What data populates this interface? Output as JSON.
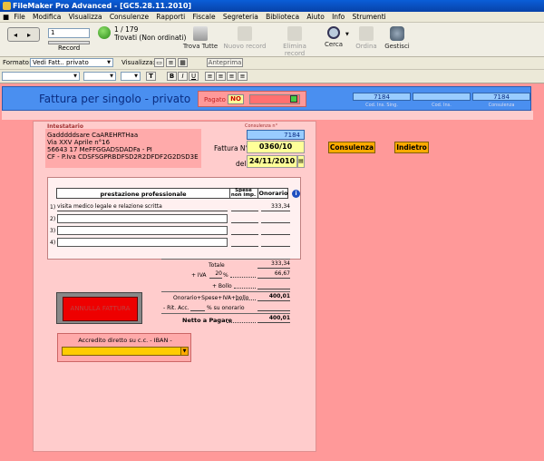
{
  "window": {
    "title": "FileMaker Pro Advanced - [GC5.28.11.2010]"
  },
  "menu": [
    "File",
    "Modifica",
    "Visualizza",
    "Consulenze",
    "Rapporti",
    "Fiscale",
    "Segreteria",
    "Biblioteca",
    "Aiuto",
    "Info",
    "Strumenti"
  ],
  "toolbar": {
    "record_number": "1",
    "record_label": "Record",
    "count": "1 / 179",
    "found_status": "Trovati (Non ordinati)",
    "trova_tutte": "Trova Tutte",
    "nuovo_record": "Nuovo record",
    "elimina_record": "Elimina record",
    "cerca": "Cerca",
    "ordina": "Ordina",
    "gestisci": "Gestisci"
  },
  "formatbar": {
    "formato_label": "Formato:",
    "formato_value": "Vedi Fatt.. privato",
    "visualizza_label": "Visualizza:",
    "anteprima": "Anteprima"
  },
  "header": {
    "title": "Fattura per singolo - privato",
    "pagato_label": "Pagato",
    "pagato_value": "NO",
    "cod_ins_sing_value": "7184",
    "cod_ins_sing_label": "Cod. Ins. Sing.",
    "cod_ins_label": "Cod. Ins.",
    "consulenza_value": "7184",
    "consulenza_label": "Consulenza"
  },
  "intestatario": {
    "label": "Intestatario",
    "lines": [
      "Gadddddsare CaAREHRTHaa",
      "Via XXV Aprile n°16",
      "56643 17 MeFFGGADSDADFa - PI",
      "CF - P.Iva CDSFSGPRBDFSD2R2DFDF2G2DSD3E"
    ]
  },
  "fattura": {
    "consulenza_label": "Consulenza n°",
    "consulenza_value": "7184",
    "numero_label": "Fattura N°",
    "numero_value": "0360/10",
    "data_label": "del",
    "data_value": "24/11/2010"
  },
  "buttons": {
    "consulenza": "Consulenza",
    "indietro": "Indietro",
    "annulla": "ANNULLA FATTURA"
  },
  "table": {
    "col_prestazione": "prestazione professionale",
    "col_spese_1": "Spese",
    "col_spese_2": "non imp.",
    "col_onorario": "Onorario",
    "rows": [
      {
        "n": "1)",
        "descr": "visita medico legale e relazione scritta",
        "onorario": "333,34"
      },
      {
        "n": "2)",
        "descr": "",
        "onorario": ""
      },
      {
        "n": "3)",
        "descr": "",
        "onorario": ""
      },
      {
        "n": "4)",
        "descr": "",
        "onorario": ""
      }
    ]
  },
  "totals": {
    "totale_label": "Totale",
    "totale_value": "333,34",
    "iva_label": "+ IVA",
    "iva_pct": "20",
    "iva_pct_suffix": "%",
    "iva_value": "66,67",
    "bollo_label": "+ Bollo",
    "onorario_spese_label": "Onorario+Spese+IVA+bollo",
    "onorario_spese_value": "400,01",
    "rit_label": "- Rit. Acc.",
    "rit_suffix": "% su onorario",
    "netto_label": "Netto a Pagare",
    "netto_value": "400,01"
  },
  "accredito": {
    "label": "Accredito diretto su c.c. - IBAN -"
  },
  "colors": {
    "background": "#ff9999",
    "header": "#4a8ff0",
    "panel": "#ffcccc",
    "yellow": "#ffff99",
    "orange": "#ffaa00"
  }
}
